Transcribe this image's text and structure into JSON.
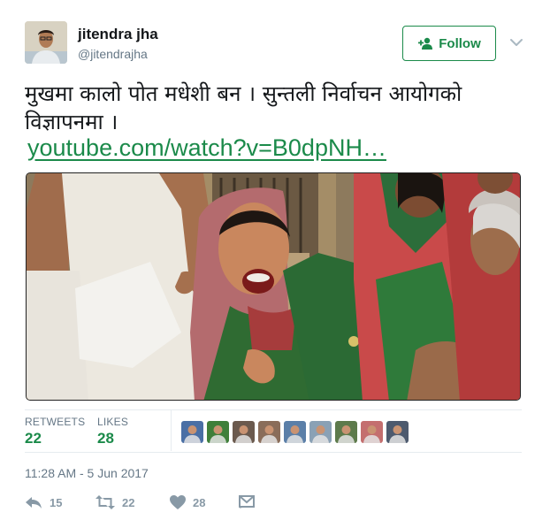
{
  "user": {
    "name": "jitendra jha",
    "handle": "@jitendrajha",
    "follow_label": "Follow"
  },
  "tweet": {
    "text": "मुखमा कालो पोत मधेशी बन । सुन्तली निर्वाचन आयोगको विज्ञापनमा ।",
    "link": "youtube.com/watch?v=B0dpNH…"
  },
  "stats": {
    "retweets_label": "RETWEETS",
    "retweets_value": "22",
    "likes_label": "LIKES",
    "likes_value": "28"
  },
  "likers": [
    {
      "icon": "avatar-1",
      "color": "#4a6fa5"
    },
    {
      "icon": "avatar-2",
      "color": "#3f7f3a"
    },
    {
      "icon": "avatar-3",
      "color": "#6b5a4e"
    },
    {
      "icon": "avatar-4",
      "color": "#8a6d5a"
    },
    {
      "icon": "avatar-5",
      "color": "#5b7fa8"
    },
    {
      "icon": "avatar-6",
      "color": "#8aa1b5"
    },
    {
      "icon": "avatar-7",
      "color": "#5d7a4b"
    },
    {
      "icon": "avatar-8",
      "color": "#c46f6f"
    },
    {
      "icon": "avatar-9",
      "color": "#4d5a6e"
    }
  ],
  "timestamp": "11:28 AM - 5 Jun 2017",
  "actions": {
    "reply_count": "15",
    "retweet_count": "22",
    "like_count": "28"
  },
  "colors": {
    "accent": "#1b8a4a",
    "muted": "#657786",
    "icon": "#8899a6"
  }
}
